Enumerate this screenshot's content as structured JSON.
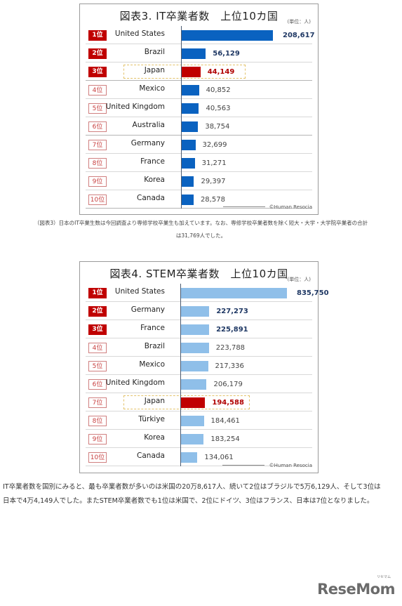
{
  "charts": [
    {
      "title": "図表3. IT卒業者数　上位10カ国",
      "unit": "(単位：人)",
      "credit": "©Human Resocia",
      "bar_color": "#0a62c0",
      "highlight_color": "#c00000",
      "rows": [
        {
          "rank": "1位",
          "country": "United States",
          "value": 208617,
          "label": "208,617",
          "top3": true
        },
        {
          "rank": "2位",
          "country": "Brazil",
          "value": 56129,
          "label": "56,129",
          "top3": true
        },
        {
          "rank": "3位",
          "country": "Japan",
          "value": 44149,
          "label": "44,149",
          "top3": true,
          "highlight": true
        },
        {
          "rank": "4位",
          "country": "Mexico",
          "value": 40852,
          "label": "40,852"
        },
        {
          "rank": "5位",
          "country": "United Kingdom",
          "value": 40563,
          "label": "40,563"
        },
        {
          "rank": "6位",
          "country": "Australia",
          "value": 38754,
          "label": "38,754"
        },
        {
          "rank": "7位",
          "country": "Germany",
          "value": 32699,
          "label": "32,699"
        },
        {
          "rank": "8位",
          "country": "France",
          "value": 31271,
          "label": "31,271"
        },
        {
          "rank": "9位",
          "country": "Korea",
          "value": 29397,
          "label": "29,397"
        },
        {
          "rank": "10位",
          "country": "Canada",
          "value": 28578,
          "label": "28,578"
        }
      ]
    },
    {
      "title": "図表4. STEM卒業者数　上位10カ国",
      "unit": "(単位：人)",
      "credit": "©Human Resocia",
      "bar_color": "#8fbfe9",
      "highlight_color": "#c00000",
      "rows": [
        {
          "rank": "1位",
          "country": "United States",
          "value": 835750,
          "label": "835,750",
          "top3": true
        },
        {
          "rank": "2位",
          "country": "Germany",
          "value": 227273,
          "label": "227,273",
          "top3": true
        },
        {
          "rank": "3位",
          "country": "France",
          "value": 225891,
          "label": "225,891",
          "top3": true
        },
        {
          "rank": "4位",
          "country": "Brazil",
          "value": 223788,
          "label": "223,788"
        },
        {
          "rank": "5位",
          "country": "Mexico",
          "value": 217336,
          "label": "217,336"
        },
        {
          "rank": "6位",
          "country": "United Kingdom",
          "value": 206179,
          "label": "206,179"
        },
        {
          "rank": "7位",
          "country": "Japan",
          "value": 194588,
          "label": "194,588",
          "highlight": true
        },
        {
          "rank": "8位",
          "country": "Türkiye",
          "value": 184461,
          "label": "184,461"
        },
        {
          "rank": "9位",
          "country": "Korea",
          "value": 183254,
          "label": "183,254"
        },
        {
          "rank": "10位",
          "country": "Canada",
          "value": 134061,
          "label": "134,061"
        }
      ]
    }
  ],
  "chart_data": [
    {
      "type": "bar",
      "orientation": "horizontal",
      "title": "図表3. IT卒業者数　上位10カ国",
      "unit": "(単位：人)",
      "categories": [
        "United States",
        "Brazil",
        "Japan",
        "Mexico",
        "United Kingdom",
        "Australia",
        "Germany",
        "France",
        "Korea",
        "Canada"
      ],
      "values": [
        208617,
        56129,
        44149,
        40852,
        40563,
        38754,
        32699,
        31271,
        29397,
        28578
      ],
      "highlighted": "Japan",
      "source": "©Human Resocia"
    },
    {
      "type": "bar",
      "orientation": "horizontal",
      "title": "図表4. STEM卒業者数　上位10カ国",
      "unit": "(単位：人)",
      "categories": [
        "United States",
        "Germany",
        "France",
        "Brazil",
        "Mexico",
        "United Kingdom",
        "Japan",
        "Türkiye",
        "Korea",
        "Canada"
      ],
      "values": [
        835750,
        227273,
        225891,
        223788,
        217336,
        206179,
        194588,
        184461,
        183254,
        134061
      ],
      "highlighted": "Japan",
      "source": "©Human Resocia"
    }
  ],
  "caption": {
    "line1": "（図表3）日本のIT卒業生数は今回調査より専修学校卒業生も加えています。なお、専修学校卒業者数を除く短大・大学・大学院卒業者の合計",
    "line2": "は31,769人でした。"
  },
  "paragraph": {
    "line1": "IT卒業者数を国別にみると、最も卒業者数が多いのは米国の20万8,617人、続いて2位はブラジルで5万6,129人、そして3位は",
    "line2": "日本で4万4,149人でした。またSTEM卒業者数でも1位は米国で、2位にドイツ、3位はフランス、日本は7位となりました。"
  },
  "logo": {
    "text": "ReseMom",
    "kana": "リセマム"
  }
}
